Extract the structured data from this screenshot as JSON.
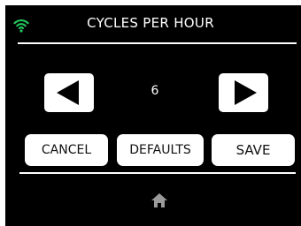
{
  "header": {
    "title": "CYCLES PER HOUR",
    "status_icon": "wifi-icon",
    "status_color": "#22c55e"
  },
  "setting": {
    "value": "6",
    "decrement_icon": "arrow-left-icon",
    "increment_icon": "arrow-right-icon"
  },
  "actions": {
    "cancel_label": "CANCEL",
    "defaults_label": "DEFAULTS",
    "save_label": "SAVE"
  },
  "footer": {
    "home_icon": "home-icon",
    "home_color": "#9a9a9a"
  }
}
